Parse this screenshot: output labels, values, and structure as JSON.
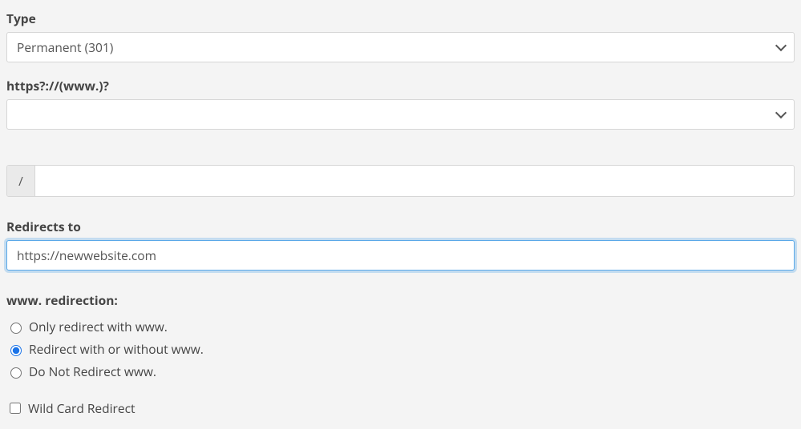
{
  "type": {
    "label": "Type",
    "selected": "Permanent (301)"
  },
  "domain": {
    "label": "https?://(www.)?"
  },
  "path": {
    "prefix": "/",
    "value": ""
  },
  "redirects_to": {
    "label": "Redirects to",
    "value": "https://newwebsite.com"
  },
  "www_redirection": {
    "label": "www. redirection:",
    "options": [
      {
        "label": "Only redirect with www."
      },
      {
        "label": "Redirect with or without www."
      },
      {
        "label": "Do Not Redirect www."
      }
    ],
    "selected_index": 1
  },
  "wildcard": {
    "label": "Wild Card Redirect",
    "checked": false
  }
}
